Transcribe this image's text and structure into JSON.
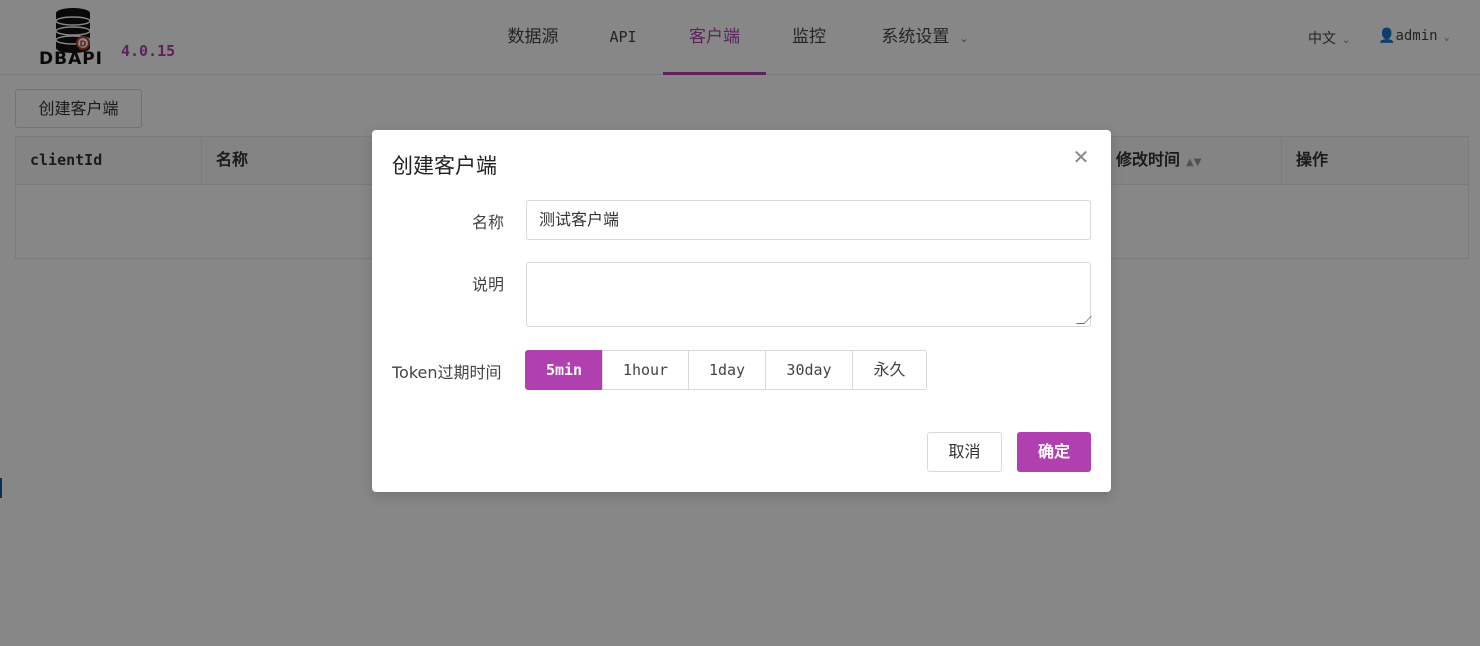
{
  "header": {
    "logo_text": "DBAPI",
    "version": "4.0.15",
    "nav": [
      {
        "label": "数据源"
      },
      {
        "label": "API"
      },
      {
        "label": "客户端"
      },
      {
        "label": "监控"
      },
      {
        "label": "系统设置"
      }
    ],
    "active_nav": "客户端",
    "language": "中文",
    "user": "admin"
  },
  "content": {
    "create_button": "创建客户端",
    "table": {
      "columns": [
        "clientId",
        "名称",
        "修改时间",
        "操作"
      ]
    }
  },
  "modal": {
    "title": "创建客户端",
    "fields": {
      "name_label": "名称",
      "name_value": "测试客户端",
      "desc_label": "说明",
      "desc_value": "",
      "token_label": "Token过期时间"
    },
    "token_options": [
      "5min",
      "1hour",
      "1day",
      "30day",
      "永久"
    ],
    "token_selected": "5min",
    "cancel_label": "取消",
    "ok_label": "确定",
    "close_icon": "close-icon"
  },
  "colors": {
    "accent": "#b03fb0",
    "mask": "rgba(0,0,0,0.47)"
  }
}
